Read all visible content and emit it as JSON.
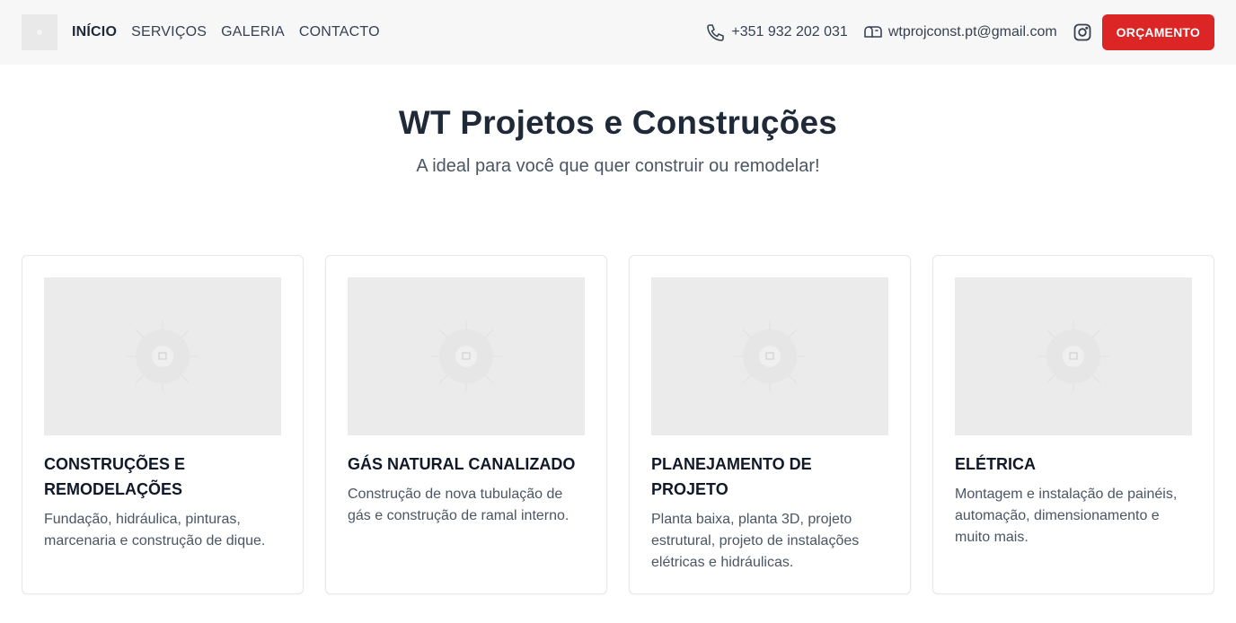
{
  "nav": {
    "items": [
      {
        "label": "INÍCIO",
        "active": true
      },
      {
        "label": "SERVIÇOS",
        "active": false
      },
      {
        "label": "GALERIA",
        "active": false
      },
      {
        "label": "CONTACTO",
        "active": false
      }
    ]
  },
  "header": {
    "phone": "+351 932 202 031",
    "phone_icon": "phone-icon",
    "email": "wtprojconst.pt@gmail.com",
    "email_icon": "mail-icon",
    "social_icon": "instagram-icon",
    "quote_button": "ORÇAMENTO",
    "accent_color": "#dc2626"
  },
  "hero": {
    "title": "WT Projetos e Construções",
    "subtitle": "A ideal para você que quer construir ou remodelar!"
  },
  "services": [
    {
      "title": "CONSTRUÇÕES E REMODELAÇÕES",
      "description": "Fundação, hidráulica, pinturas, marcenaria e construção de dique."
    },
    {
      "title": "GÁS NATURAL CANALIZADO",
      "description": "Construção de nova tubulação de gás e construção de ramal interno."
    },
    {
      "title": "PLANEJAMENTO DE PROJETO",
      "description": "Planta baixa, planta 3D, projeto estrutural, projeto de instalações elétricas e hidráulicas."
    },
    {
      "title": "ELÉTRICA",
      "description": "Montagem e instalação de painéis, automação, dimensionamento e muito mais."
    }
  ]
}
